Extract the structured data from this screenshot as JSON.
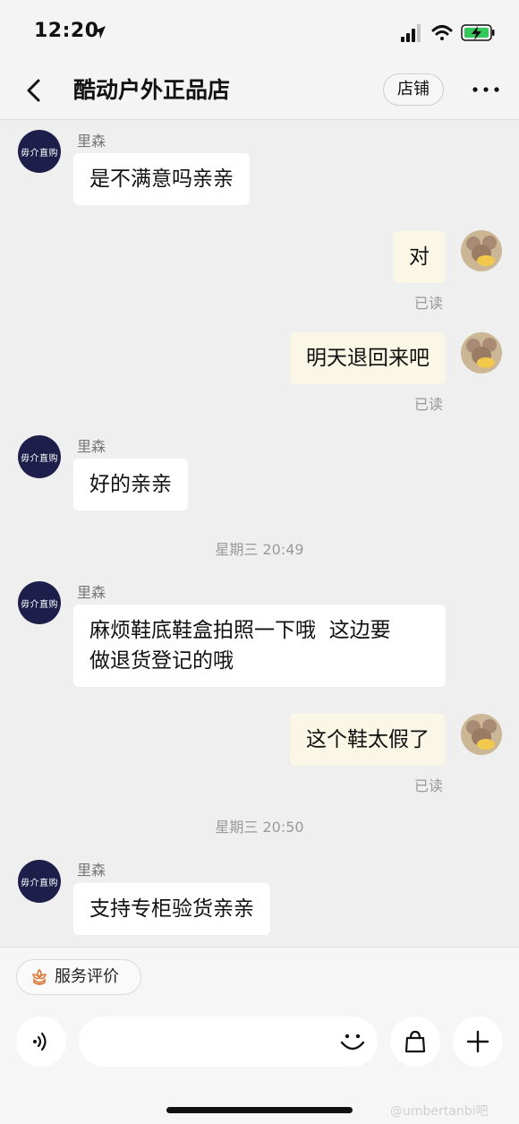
{
  "status_bar": {
    "time": "12:20"
  },
  "header": {
    "title": "酷动户外正品店",
    "shop_button": "店铺"
  },
  "messages": [
    {
      "sender": "里森",
      "text": "是不满意吗亲亲"
    },
    {
      "text": "对",
      "status": "已读"
    },
    {
      "text": "明天退回来吧",
      "status": "已读"
    },
    {
      "sender": "里森",
      "text": "好的亲亲"
    },
    {
      "divider": "星期三 20:49"
    },
    {
      "sender": "里森",
      "line1": "麻烦鞋底鞋盒拍照一下哦  这边要",
      "line2": "做退货登记的哦"
    },
    {
      "text": "这个鞋太假了",
      "status": "已读"
    },
    {
      "divider": "星期三 20:50"
    },
    {
      "sender": "里森",
      "text": "支持专柜验货亲亲"
    }
  ],
  "store_avatar_text": "毋介直购",
  "bottom": {
    "service_label": "服务评价",
    "input_placeholder": ""
  },
  "watermark": "@umbertanbi吧",
  "colors": {
    "background": "#efefef",
    "incoming_bubble": "#ffffff",
    "outgoing_bubble": "#fbf7e6",
    "store_avatar": "#1d1f4a",
    "service_icon": "#e07a3a"
  }
}
